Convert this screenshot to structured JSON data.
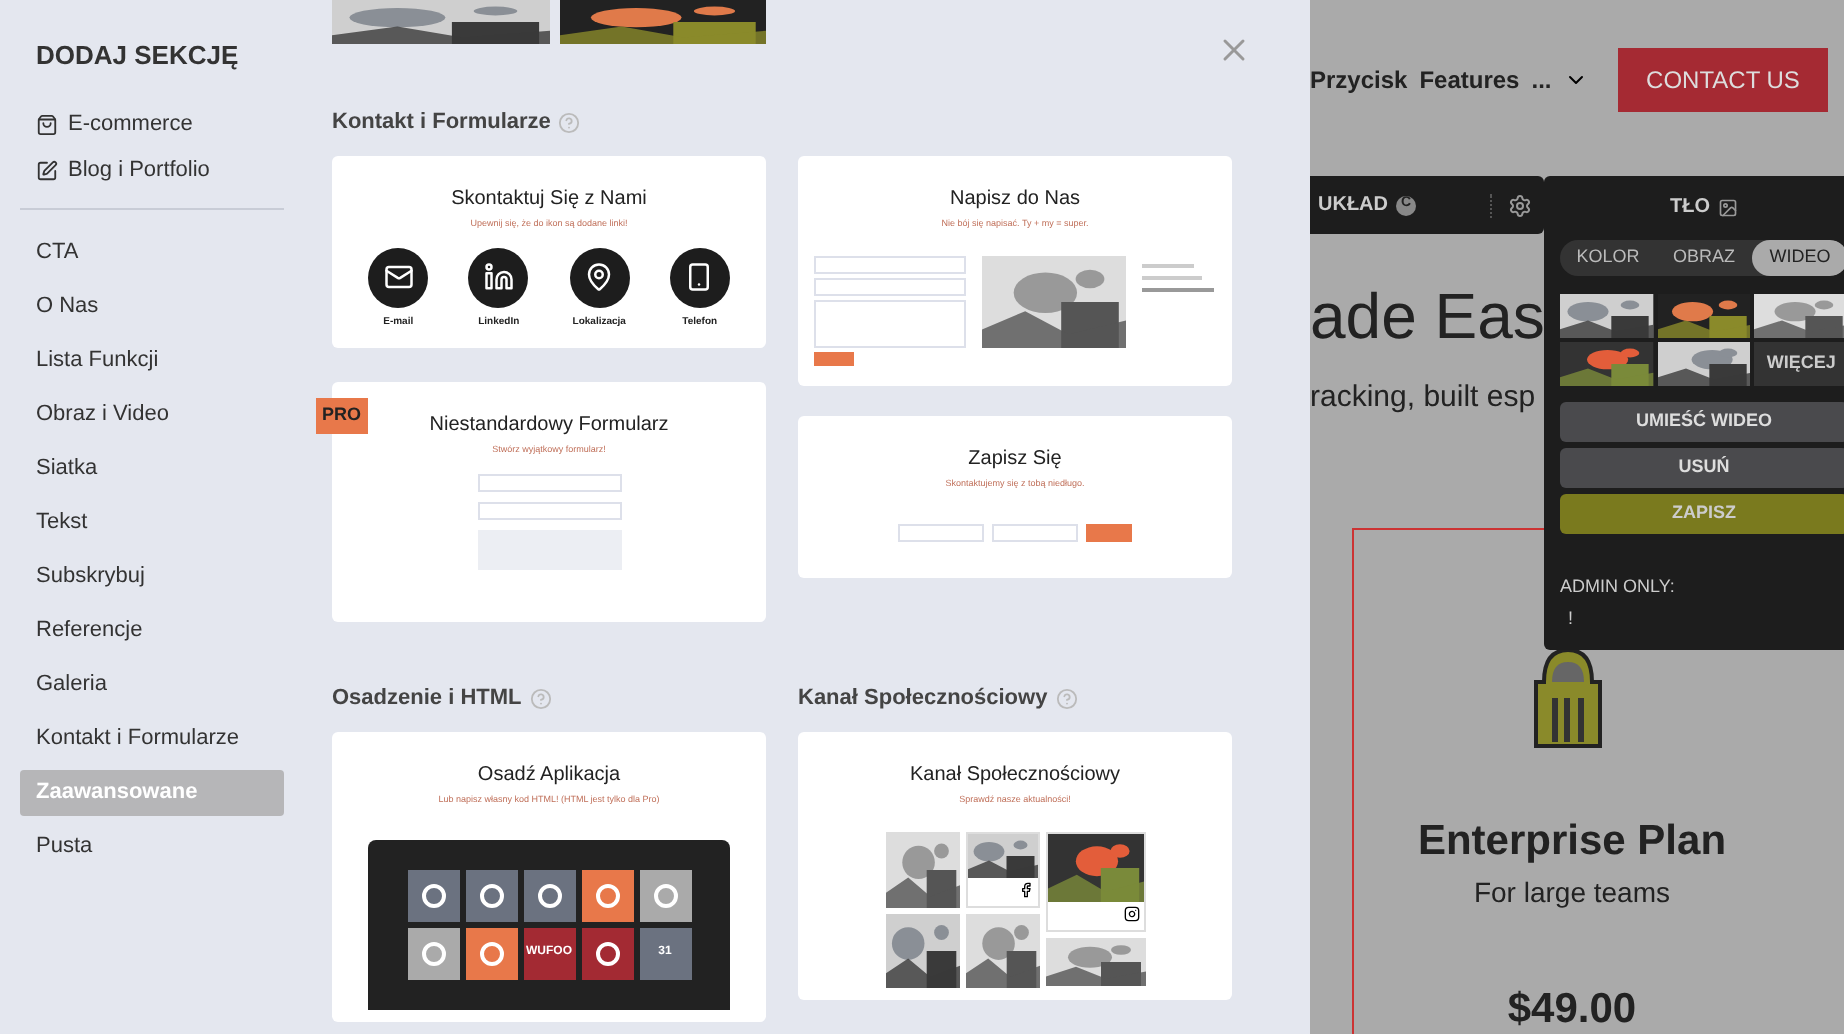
{
  "sidebar": {
    "title": "DODAJ SEKCJĘ",
    "top_items": [
      {
        "label": "E-commerce",
        "kind": "shop"
      },
      {
        "label": "Blog i Portfolio",
        "kind": "edit"
      }
    ],
    "items": [
      {
        "label": "CTA",
        "selected": false
      },
      {
        "label": "O Nas",
        "selected": false
      },
      {
        "label": "Lista Funkcji",
        "selected": false
      },
      {
        "label": "Obraz i Video",
        "selected": false
      },
      {
        "label": "Siatka",
        "selected": false
      },
      {
        "label": "Tekst",
        "selected": false
      },
      {
        "label": "Subskrybuj",
        "selected": false
      },
      {
        "label": "Referencje",
        "selected": false
      },
      {
        "label": "Galeria",
        "selected": false
      },
      {
        "label": "Kontakt i Formularze",
        "selected": false
      },
      {
        "label": "Zaawansowane",
        "selected": true
      },
      {
        "label": "Pusta",
        "selected": false
      }
    ]
  },
  "sections": [
    {
      "title": "Kontakt i Formularze",
      "columns": [
        [
          {
            "kind": "icons",
            "title": "Skontaktuj Się z Nami",
            "subtitle": "Upewnij się, że do ikon są dodane linki!",
            "icons": [
              {
                "kind": "mail",
                "label": "E-mail"
              },
              {
                "kind": "linkedin",
                "label": "LinkedIn"
              },
              {
                "kind": "pin",
                "label": "Lokalizacja"
              },
              {
                "kind": "phone",
                "label": "Telefon"
              }
            ]
          },
          {
            "kind": "form",
            "title": "Niestandardowy Formularz",
            "subtitle": "Stwórz wyjątkowy formularz!",
            "badge": "PRO"
          }
        ],
        [
          {
            "kind": "map",
            "title": "Napisz do Nas",
            "subtitle": "Nie bój się napisać. Ty + my = super."
          },
          {
            "kind": "subscribe",
            "title": "Zapisz Się",
            "subtitle": "Skontaktujemy się z tobą niedługo."
          }
        ]
      ]
    },
    {
      "title": "Osadzenie i HTML",
      "columns": [
        [
          {
            "kind": "apps",
            "title": "Osadź Aplikacja",
            "subtitle": "Lub napisz własny kod HTML! (HTML jest tylko dla Pro)",
            "tiles": [
              {
                "kind": "code"
              },
              {
                "kind": "paypal"
              },
              {
                "kind": "facebook"
              },
              {
                "kind": "cloud"
              },
              {
                "kind": "monkey"
              },
              {
                "kind": "maps"
              },
              {
                "kind": "e"
              },
              {
                "kind": "wufoo",
                "label": "WUFOO"
              },
              {
                "kind": "pinterest"
              },
              {
                "kind": "calendar",
                "label": "31"
              }
            ]
          }
        ]
      ]
    },
    {
      "title": "Kanał Społecznościowy",
      "columns": [
        [
          {
            "kind": "feed",
            "title": "Kanał Społecznościowy",
            "subtitle": "Sprawdź nasze aktualności!"
          }
        ]
      ]
    }
  ],
  "site": {
    "nav": [
      "Przycisk",
      "Features",
      "..."
    ],
    "cta": "CONTACT US",
    "toolbar": {
      "label": "UKŁAD",
      "badge": "C"
    },
    "headline": "ade Eas",
    "tagline": "racking, built esp",
    "plan": {
      "title": "Enterprise Plan",
      "subtitle": "For large teams",
      "price": "$49.00"
    }
  },
  "bg_panel": {
    "title": "TŁO",
    "tabs": [
      {
        "label": "KOLOR",
        "selected": false
      },
      {
        "label": "OBRAZ",
        "selected": false
      },
      {
        "label": "WIDEO",
        "selected": true
      }
    ],
    "more": "WIĘCEJ",
    "buttons": [
      {
        "label": "UMIEŚĆ WIDEO",
        "kind": "plain"
      },
      {
        "label": "USUŃ",
        "kind": "plain"
      },
      {
        "label": "ZAPISZ",
        "kind": "primary"
      }
    ],
    "admin_label": "ADMIN ONLY:",
    "admin_value": "!"
  }
}
